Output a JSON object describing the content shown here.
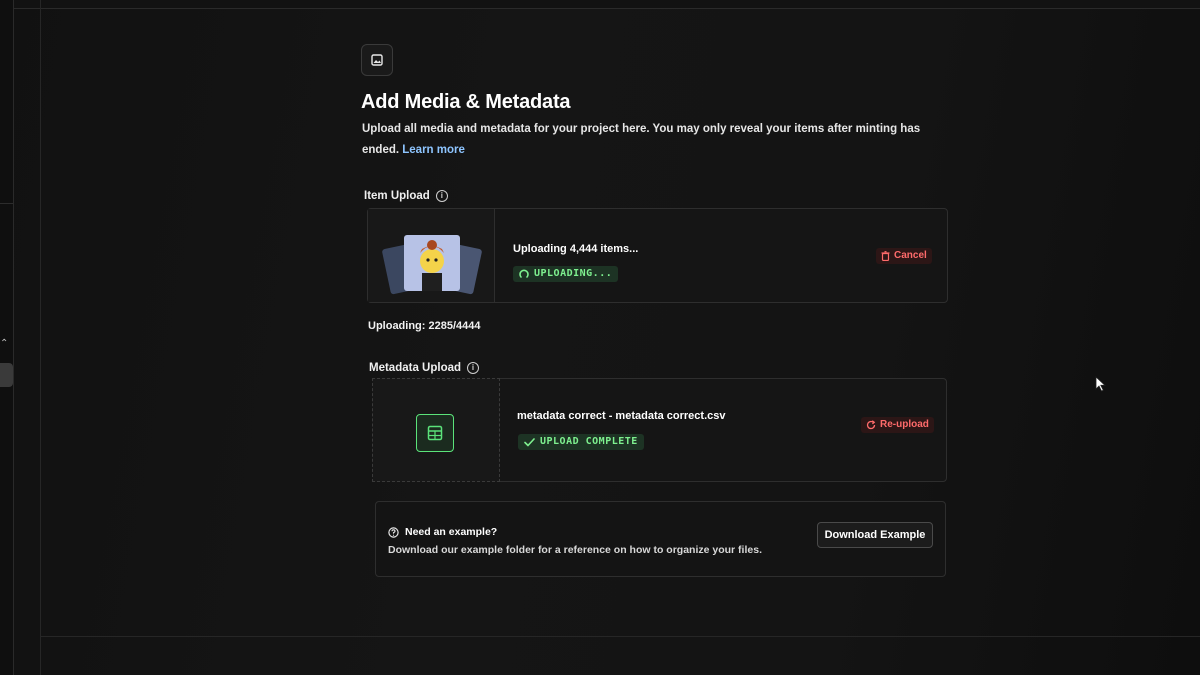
{
  "page": {
    "title": "Add Media & Metadata",
    "description": "Upload all media and metadata for your project here. You may only reveal your items after minting has ended.",
    "learn_more": "Learn more"
  },
  "item_upload": {
    "label": "Item Upload",
    "card_title": "Uploading 4,444 items...",
    "status": "UPLOADING...",
    "cancel_label": "Cancel",
    "progress_text": "Uploading: 2285/4444",
    "progress_fraction": 0.514
  },
  "metadata_upload": {
    "label": "Metadata Upload",
    "file_name": "metadata correct - metadata correct.csv",
    "status": "UPLOAD COMPLETE",
    "reupload_label": "Re-upload"
  },
  "example": {
    "title": "Need an example?",
    "description": "Download our example folder for a reference on how to organize your files.",
    "button_label": "Download Example"
  },
  "icons": {
    "header": "image-icon",
    "info": "info-icon",
    "spinner": "spinner-icon",
    "trash": "trash-icon",
    "check": "check-icon",
    "refresh": "refresh-icon",
    "table": "table-icon",
    "help": "help-circle-icon"
  },
  "colors": {
    "success": "#7ef08f",
    "danger": "#ff6b6b",
    "link": "#8ec5ff"
  }
}
